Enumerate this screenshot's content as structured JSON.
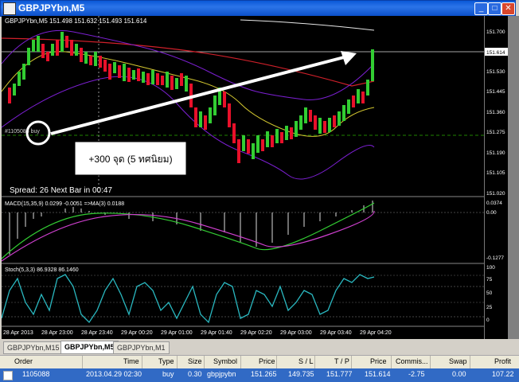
{
  "window": {
    "title": "GBPJPYbn,M5"
  },
  "chart": {
    "info": "GBPJPYbn,M5  151.498 151.632 151.493 151.614",
    "price_levels": [
      "151.700",
      "151.614",
      "151.530",
      "151.445",
      "151.360",
      "151.275",
      "151.190",
      "151.105",
      "151.020"
    ],
    "order_label": "#1105088 buy",
    "annotation": "+300 จุด (5 ทศนิยม)",
    "spread_text": "Spread: 26  Next Bar in 00:47",
    "macd_label": "MACD(15,35,9) 0.0299 -0.0051 =>MA(3) 0.0188",
    "macd_levels": [
      "0.0374",
      "0.00",
      "-0.1277"
    ],
    "stoch_label": "Stoch(5,3,3) 86.9328 86.1460",
    "stoch_levels": [
      "100",
      "75",
      "50",
      "25",
      "0"
    ],
    "time_labels": [
      "28 Apr 2013",
      "28 Apr 23:00",
      "28 Apr 23:40",
      "29 Apr 00:20",
      "29 Apr 01:00",
      "29 Apr 01:40",
      "29 Apr 02:20",
      "29 Apr 03:00",
      "29 Apr 03:40",
      "29 Apr 04:20"
    ]
  },
  "tabs": [
    "GBPJPYbn,M15",
    "GBPJPYbn,M5",
    "GBPJPYbn,M1"
  ],
  "table": {
    "headers": [
      "Order",
      "Time",
      "Type",
      "Size",
      "Symbol",
      "Price",
      "S / L",
      "T / P",
      "Price",
      "Commis...",
      "Swap",
      "Profit"
    ],
    "row": [
      "1105088",
      "2013.04.29 02:30",
      "buy",
      "0.30",
      "gbpjpybn",
      "151.265",
      "149.735",
      "151.777",
      "151.614",
      "-2.75",
      "0.00",
      "107.22"
    ]
  },
  "colors": {
    "bull": "#32cd32",
    "bear": "#e8102a",
    "ma_red": "#d0202a",
    "bands": "#7b1fd1",
    "stoch": "#2ab8c0",
    "macd_line": "#33cc33",
    "macd_signal": "#d040d0"
  }
}
